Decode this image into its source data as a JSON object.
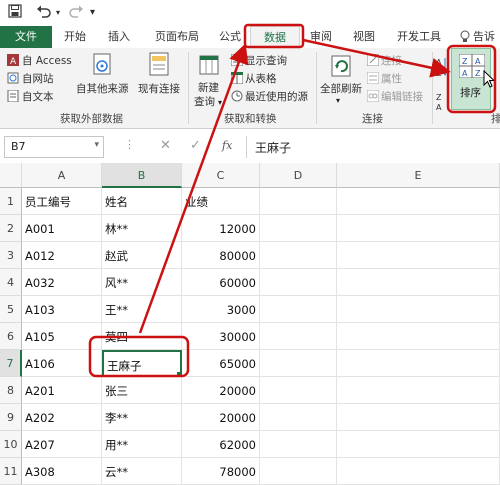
{
  "qat": {
    "save_icon": "save-icon",
    "undo_icon": "undo-icon",
    "redo_icon": "redo-icon",
    "customize_icon": "customize-icon"
  },
  "tabs": [
    "文件",
    "开始",
    "插入",
    "页面布局",
    "公式",
    "数据",
    "审阅",
    "视图",
    "开发工具"
  ],
  "tell_me": "告诉",
  "ribbon": {
    "get_external": {
      "access": "自 Access",
      "web": "自网站",
      "text": "自文本",
      "other_sources": "自其他来源",
      "existing": "现有连接",
      "group_label": "获取外部数据"
    },
    "get_transform": {
      "new_query_line1": "新建",
      "new_query_line2": "查询",
      "show_queries": "显示查询",
      "from_table": "从表格",
      "recent_sources": "最近使用的源",
      "group_label": "获取和转换"
    },
    "connections": {
      "refresh_all": "全部刷新",
      "connections": "连接",
      "properties": "属性",
      "edit_links": "编辑链接",
      "group_label": "连接"
    },
    "sort_filter": {
      "sort": "排序",
      "group_label_partial": "排"
    }
  },
  "formula_bar": {
    "name_box": "B7",
    "fx": "fx",
    "value": "王麻子"
  },
  "columns": [
    "A",
    "B",
    "C",
    "D",
    "E"
  ],
  "rows": [
    {
      "n": "1",
      "a": "员工编号",
      "b": "姓名",
      "c": "业绩"
    },
    {
      "n": "2",
      "a": "A001",
      "b": "林**",
      "c": "12000"
    },
    {
      "n": "3",
      "a": "A012",
      "b": "赵武",
      "c": "80000"
    },
    {
      "n": "4",
      "a": "A032",
      "b": "风**",
      "c": "60000"
    },
    {
      "n": "5",
      "a": "A103",
      "b": "王**",
      "c": "3000"
    },
    {
      "n": "6",
      "a": "A105",
      "b": "莫四",
      "c": "30000"
    },
    {
      "n": "7",
      "a": "A106",
      "b": "王麻子",
      "c": "65000"
    },
    {
      "n": "8",
      "a": "A201",
      "b": "张三",
      "c": "20000"
    },
    {
      "n": "9",
      "a": "A202",
      "b": "李**",
      "c": "20000"
    },
    {
      "n": "10",
      "a": "A207",
      "b": "用**",
      "c": "62000"
    },
    {
      "n": "11",
      "a": "A308",
      "b": "云**",
      "c": "78000"
    }
  ],
  "selected_cell": "B7",
  "colors": {
    "excel_green": "#217346",
    "annotation_red": "#cc1111"
  }
}
